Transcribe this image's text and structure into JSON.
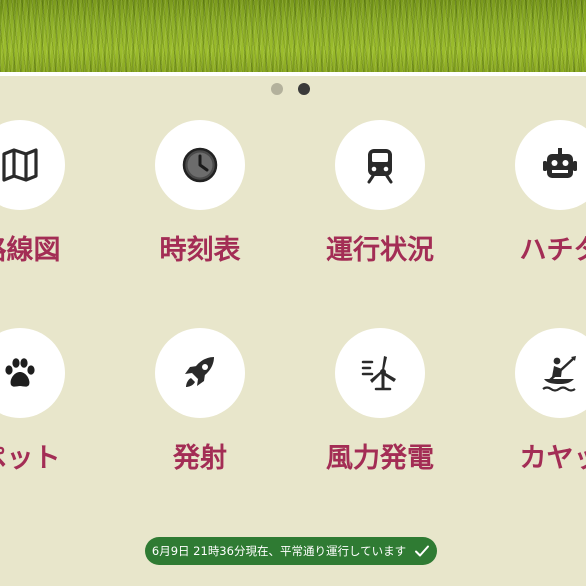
{
  "carousel": {
    "slides": 2,
    "active_index": 1
  },
  "menu": {
    "items": [
      {
        "label": "路線図",
        "icon": "map-icon"
      },
      {
        "label": "時刻表",
        "icon": "clock-icon"
      },
      {
        "label": "運行状況",
        "icon": "train-icon"
      },
      {
        "label": "ハチタ",
        "icon": "robot-icon"
      },
      {
        "label": "ペット",
        "icon": "paw-icon"
      },
      {
        "label": "発射",
        "icon": "rocket-icon"
      },
      {
        "label": "風力発電",
        "icon": "wind-turbine-icon"
      },
      {
        "label": "カヤッ",
        "icon": "kayak-icon"
      }
    ]
  },
  "status": {
    "text": "6月9日 21時36分現在、平常通り運行しています",
    "icon": "check-icon",
    "color": "#2f7b33"
  },
  "colors": {
    "accent": "#a32d55",
    "background": "#e8e6cb"
  }
}
